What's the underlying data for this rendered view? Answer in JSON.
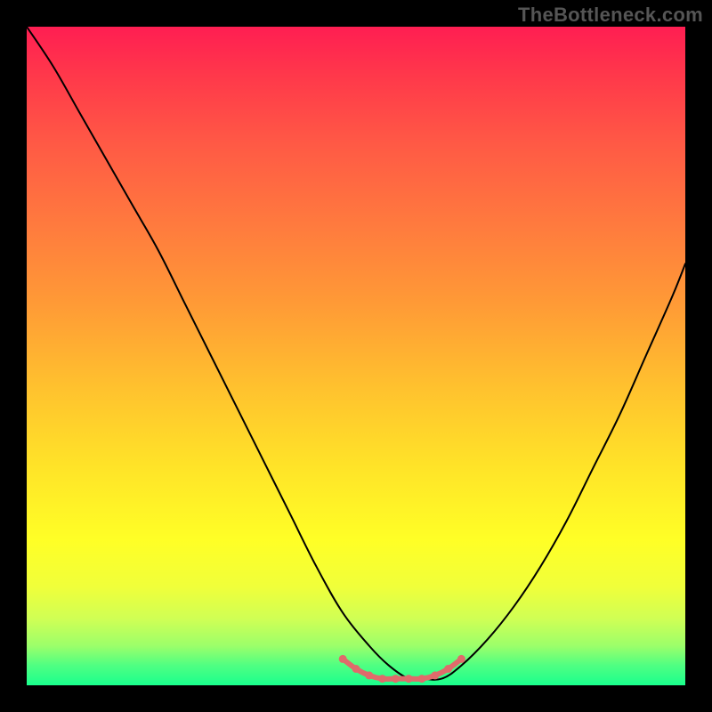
{
  "watermark": "TheBottleneck.com",
  "chart_data": {
    "type": "line",
    "title": "",
    "xlabel": "",
    "ylabel": "",
    "xlim": [
      0,
      100
    ],
    "ylim": [
      0,
      100
    ],
    "grid": false,
    "legend": false,
    "background_gradient": {
      "direction": "vertical",
      "stops": [
        {
          "pos": 0.0,
          "color": "#ff1e52"
        },
        {
          "pos": 0.3,
          "color": "#ff7a3e"
        },
        {
          "pos": 0.55,
          "color": "#ffc22e"
        },
        {
          "pos": 0.78,
          "color": "#ffff26"
        },
        {
          "pos": 0.94,
          "color": "#9cff6a"
        },
        {
          "pos": 1.0,
          "color": "#1aff8d"
        }
      ]
    },
    "series": [
      {
        "name": "curve",
        "color": "#000000",
        "width": 2,
        "x": [
          0,
          4,
          8,
          12,
          16,
          20,
          24,
          28,
          32,
          36,
          40,
          44,
          48,
          52,
          55,
          58,
          60,
          63,
          66,
          70,
          74,
          78,
          82,
          86,
          90,
          94,
          98,
          100
        ],
        "y": [
          100,
          94,
          87,
          80,
          73,
          66,
          58,
          50,
          42,
          34,
          26,
          18,
          11,
          6,
          3,
          1,
          1,
          1,
          3,
          7,
          12,
          18,
          25,
          33,
          41,
          50,
          59,
          64
        ]
      },
      {
        "name": "highlight-bottom",
        "color": "#e06b6b",
        "width": 6,
        "x": [
          48,
          50,
          52,
          54,
          56,
          58,
          60,
          62,
          64,
          66
        ],
        "y": [
          4,
          2.5,
          1.5,
          1,
          1,
          1,
          1,
          1.5,
          2.5,
          4
        ]
      }
    ]
  }
}
